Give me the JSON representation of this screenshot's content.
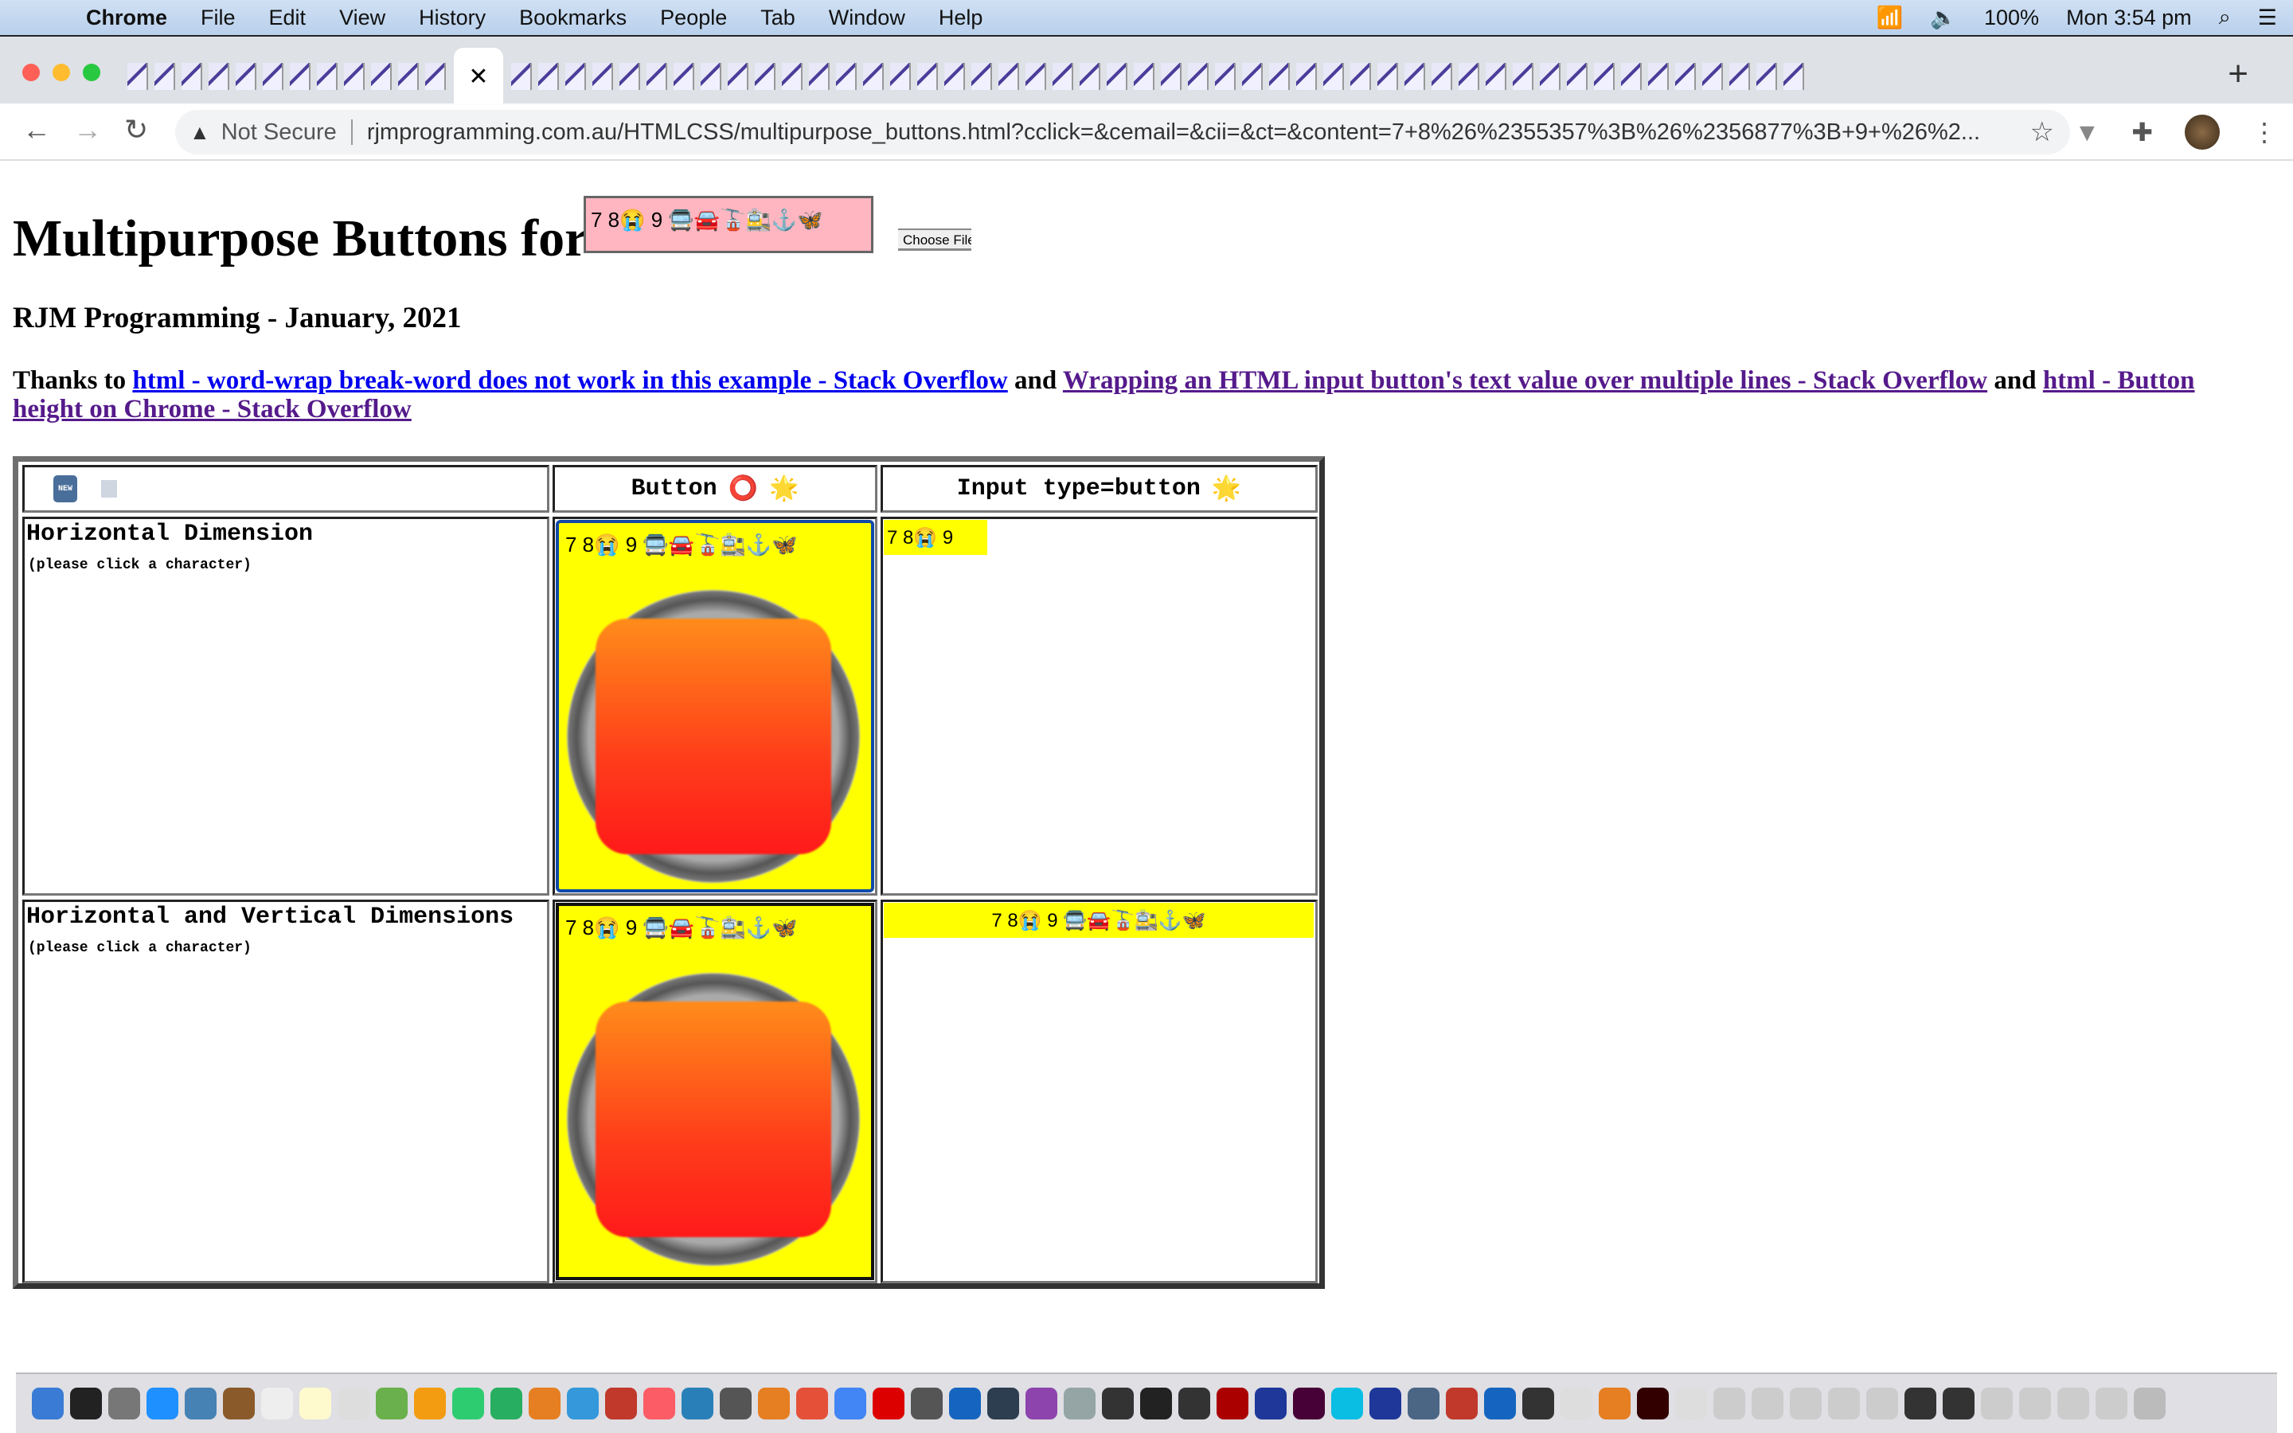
{
  "menubar": {
    "app": "Chrome",
    "items": [
      "File",
      "Edit",
      "View",
      "History",
      "Bookmarks",
      "People",
      "Tab",
      "Window",
      "Help"
    ],
    "battery": "100%",
    "clock": "Mon 3:54 pm"
  },
  "browser": {
    "security": "Not Secure",
    "url": "rjmprogramming.com.au/HTMLCSS/multipurpose_buttons.html?cclick=&cemail=&cii=&ct=&content=7+8%26%2355357%3B%26%2356877%3B+9+%26%2...",
    "new_tab": "+"
  },
  "page": {
    "title": "Multipurpose Buttons for",
    "textarea_value": "7 8😭  9 🚍🚘🚡🚉⚓🦋",
    "choose_file": "Choose File",
    "subtitle": "RJM Programming - January, 2021",
    "thanks_prefix": "Thanks to",
    "and1": "and",
    "and2": "and",
    "links": [
      "html - word-wrap break-word does not work in this example - Stack Overflow",
      "Wrapping an HTML input button's text value over multiple lines - Stack Overflow",
      "html - Button height on Chrome - Stack Overflow"
    ]
  },
  "table": {
    "header": {
      "col1_icons": [
        "new-badge-icon",
        "image-icon"
      ],
      "button": "Button",
      "button_icon": "⭕",
      "input": "Input type=button",
      "star_icon": "🌟"
    },
    "rows": [
      {
        "label": "Horizontal Dimension",
        "hint": "(please click a character)",
        "button_text": "7 8😭  9 🚍🚘🚡🚉⚓🦋",
        "input_value": "7 8😭  9"
      },
      {
        "label": "Horizontal and Vertical Dimensions",
        "hint": "(please click a character)",
        "button_text": "7 8😭  9 🚍🚘🚡🚉⚓🦋",
        "input_value": "7 8😭  9 🚍🚘🚡🚉⚓🦋"
      }
    ]
  },
  "colors": {
    "textarea_bg": "#ffb6c1",
    "button_bg": "#ffff00",
    "link": "#0000ee",
    "visited": "#551a8b"
  }
}
